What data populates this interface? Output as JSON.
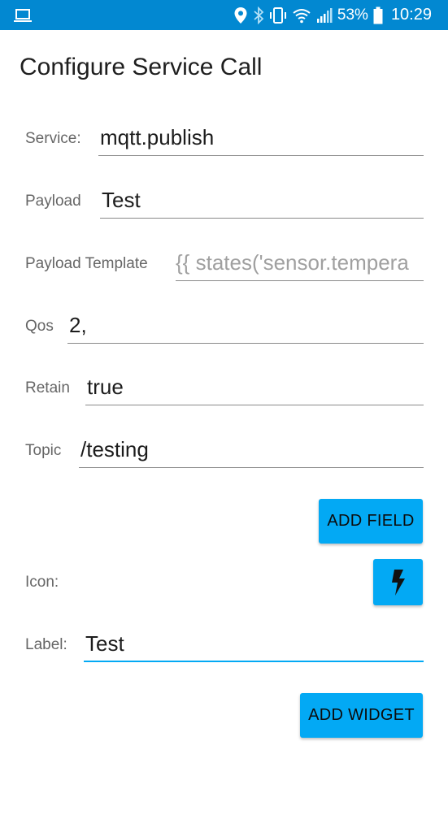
{
  "status_bar": {
    "battery_percent": "53%",
    "time": "10:29",
    "color": "#0288d1",
    "icons": [
      "laptop-icon",
      "location-pin-icon",
      "bluetooth-icon",
      "vibrate-icon",
      "wifi-icon",
      "signal-icon",
      "battery-icon"
    ]
  },
  "screen": {
    "title": "Configure Service Call"
  },
  "form": {
    "service": {
      "label": "Service:",
      "value": "mqtt.publish"
    },
    "payload": {
      "label": "Payload",
      "value": "Test"
    },
    "payload_template": {
      "label": "Payload Template",
      "placeholder": "{{ states('sensor.tempera"
    },
    "qos": {
      "label": "Qos",
      "value": "2,"
    },
    "retain": {
      "label": "Retain",
      "value": "true"
    },
    "topic": {
      "label": "Topic",
      "value": "/testing"
    },
    "add_field_label": "ADD FIELD",
    "icon": {
      "label": "Icon:",
      "icon_name": "flash-icon"
    },
    "label_field": {
      "label": "Label:",
      "value": "Test"
    },
    "add_widget_label": "ADD WIDGET"
  },
  "colors": {
    "accent": "#03a9f4",
    "status_bar": "#0288d1"
  }
}
